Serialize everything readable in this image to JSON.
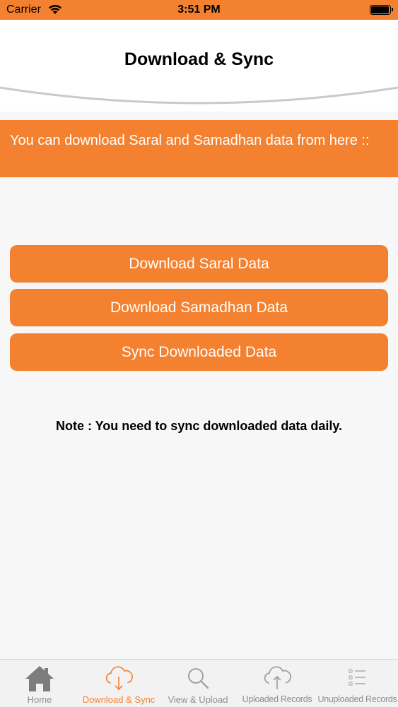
{
  "status_bar": {
    "carrier": "Carrier",
    "time": "3:51 PM",
    "battery_level": 0.95
  },
  "header": {
    "title": "Download & Sync"
  },
  "banner": {
    "text": "You can download Saral and Samadhan data from here ::"
  },
  "actions": {
    "download_saral": "Download Saral Data",
    "download_samadhan": "Download Samadhan Data",
    "sync_downloaded": "Sync Downloaded Data"
  },
  "note": "Note : You need to sync downloaded data daily.",
  "tabbar": {
    "tabs": [
      {
        "label": "Home",
        "icon": "home-icon"
      },
      {
        "label": "Download & Sync",
        "icon": "cloud-download-icon"
      },
      {
        "label": "View & Upload",
        "icon": "search-icon"
      },
      {
        "label": "Uploaded Records",
        "icon": "cloud-upload-icon"
      },
      {
        "label": "Unuploaded Records",
        "icon": "list-icon"
      }
    ],
    "active_index": 1
  },
  "colors": {
    "accent": "#f4812f",
    "background": "#f7f7f7",
    "tab_inactive": "#8e8e8e"
  }
}
